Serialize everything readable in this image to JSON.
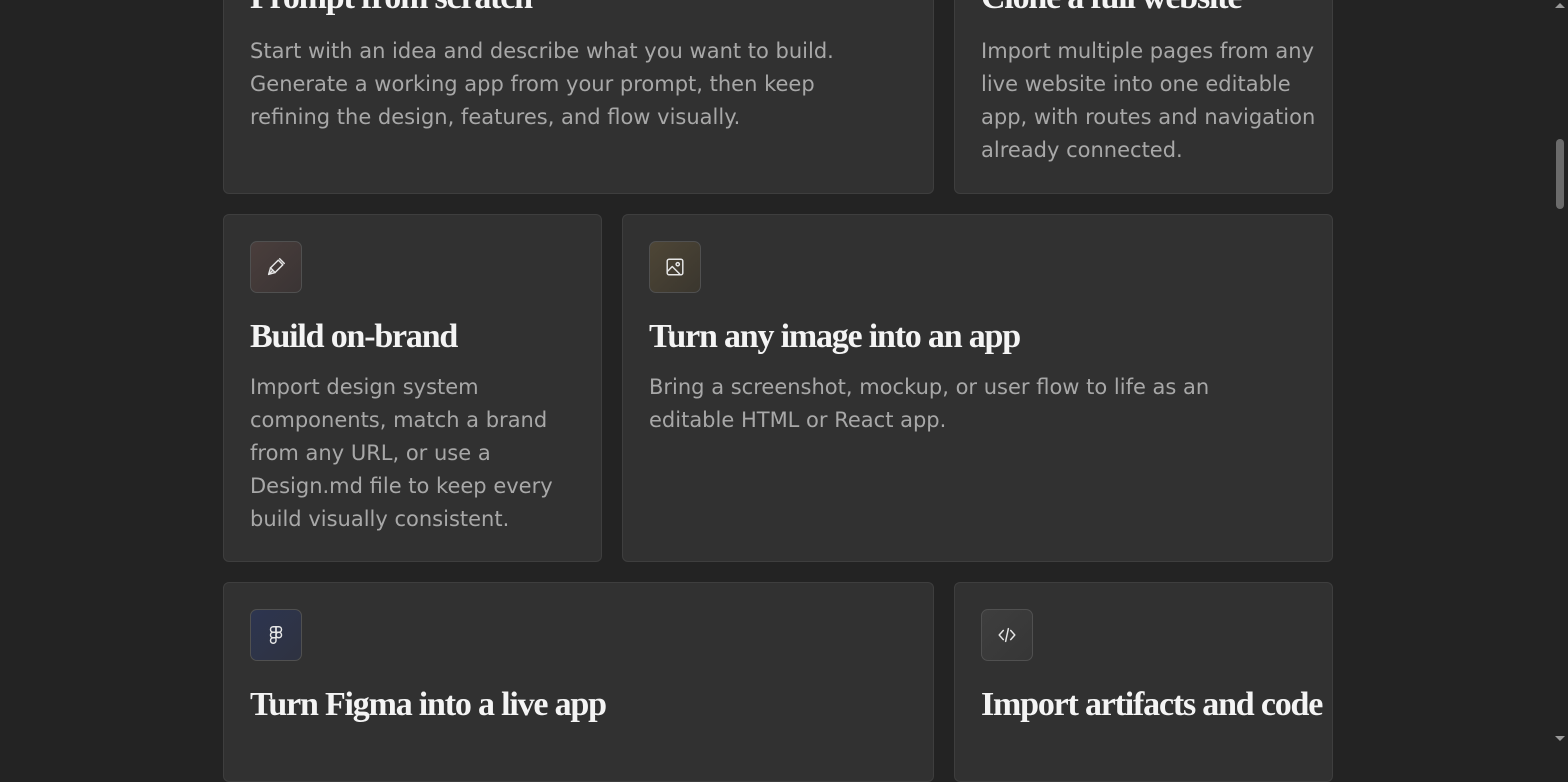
{
  "cards": [
    {
      "title": "Prompt from scratch",
      "description": "Start with an idea and describe what you want to build. Generate a working app from your prompt, then keep refining the design, features, and flow visually."
    },
    {
      "title": "Clone a full website",
      "description": "Import multiple pages from any live website into one editable app, with routes and navigation already connected."
    },
    {
      "title": "Build on-brand",
      "description": "Import design system components, match a brand from any URL, or use a Design.md file to keep every build visually consistent.",
      "icon": "pen-nib-icon"
    },
    {
      "title": "Turn any image into an app",
      "description": "Bring a screenshot, mockup, or user flow to life as an editable HTML or React app.",
      "icon": "image-icon"
    },
    {
      "title": "Turn Figma into a live app",
      "icon": "figma-icon"
    },
    {
      "title": "Import artifacts and code",
      "icon": "code-icon"
    }
  ],
  "colors": {
    "background": "#232323",
    "card": "#313131",
    "title": "#f4f4f4",
    "description": "#a8a8a8"
  }
}
